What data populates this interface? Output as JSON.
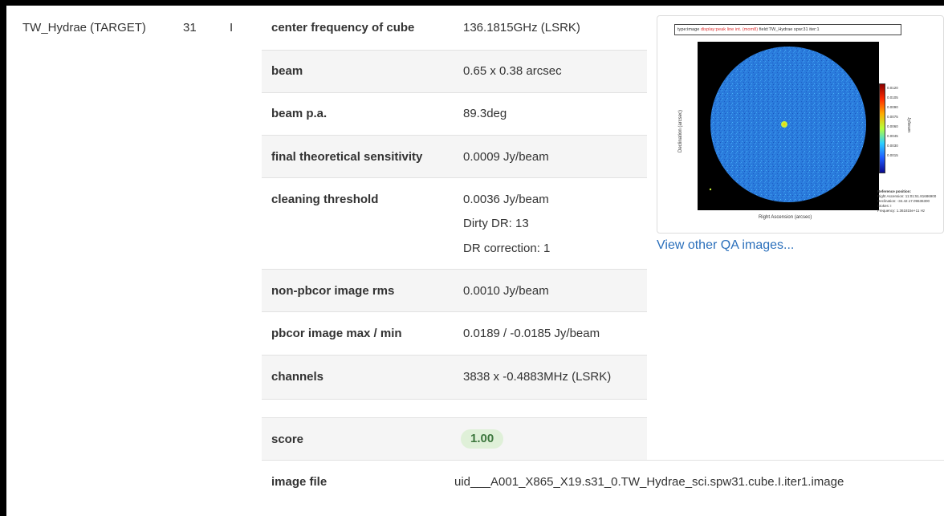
{
  "row_header": {
    "field": "TW_Hydrae (TARGET)",
    "spw": "31",
    "pol": "I"
  },
  "properties": [
    {
      "label": "center frequency of cube",
      "value": "136.1815GHz (LSRK)"
    },
    {
      "label": "beam",
      "value": "0.65 x 0.38 arcsec"
    },
    {
      "label": "beam p.a.",
      "value": "89.3deg"
    },
    {
      "label": "final theoretical sensitivity",
      "value": "0.0009 Jy/beam"
    },
    {
      "label": "cleaning threshold",
      "value": "0.0036 Jy/beam",
      "extra": [
        "Dirty DR: 13",
        "DR correction: 1"
      ]
    },
    {
      "label": "non-pbcor image rms",
      "value": "0.0010 Jy/beam"
    },
    {
      "label": "pbcor image max / min",
      "value": "0.0189 / -0.0185 Jy/beam"
    },
    {
      "label": "channels",
      "value": "3838 x -0.4883MHz (LSRK)"
    }
  ],
  "score": {
    "label": "score",
    "value": "1.00"
  },
  "image_file": {
    "label": "image file",
    "value": "uid___A001_X865_X19.s31_0.TW_Hydrae_sci.spw31.cube.I.iter1.image"
  },
  "thumbnail": {
    "title_prefix": "type:image",
    "title_red": "display:peak line int. (mom8)",
    "title_suffix": "field:TW_Hydrae  spw:31  iter:1",
    "ylabel": "Declination (arcsec)",
    "xlabel": "Right Ascension (arcsec)",
    "colorbar_ticks": [
      "0.0120",
      "0.0105",
      "0.0090",
      "0.0075",
      "0.0060",
      "0.0045",
      "0.0030",
      "0.0015"
    ],
    "colorbar_unit": "Jy/beam",
    "ref_title": "Reference position:",
    "ref_lines": [
      "Right Ascension: 11:01:51.81686900",
      "Declination: -34.42.17.09636300",
      "Stokes: I",
      "Frequency: 1.361815e+11 Hz"
    ]
  },
  "link_label": "View other QA images...",
  "colors": {
    "score_bg": "#dff0d8",
    "score_fg": "#3c763d",
    "link": "#2a6fbb",
    "row_alt": "#f5f5f5"
  }
}
